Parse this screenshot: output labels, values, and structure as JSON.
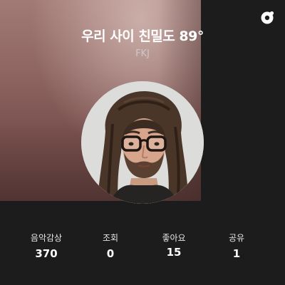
{
  "header": {
    "title": "우리 사이 친밀도 89°",
    "artist": "FKJ",
    "logo_icon": "app-logo-icon"
  },
  "colors": {
    "background": "#1c1c1c",
    "card_tint": "#8f6662",
    "text_primary": "#ffffff",
    "text_secondary": "#c9c9c9"
  },
  "avatar": {
    "icon": "artist-photo"
  },
  "stats": [
    {
      "label": "음악감상",
      "value": "370"
    },
    {
      "label": "조회",
      "value": "0"
    },
    {
      "label": "좋아요",
      "value": "15"
    },
    {
      "label": "공유",
      "value": "1"
    }
  ]
}
